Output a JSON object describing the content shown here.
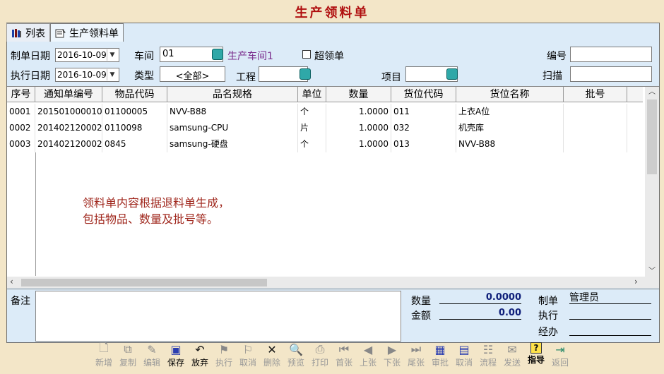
{
  "title": "生产领料单",
  "tabs": [
    {
      "label": "列表",
      "icon": "books-icon"
    },
    {
      "label": "生产领料单",
      "icon": "form-icon"
    }
  ],
  "form": {
    "make_date_label": "制单日期",
    "make_date": "2016-10-09",
    "exec_date_label": "执行日期",
    "exec_date": "2016-10-09",
    "workshop_label": "车间",
    "workshop_code": "01",
    "workshop_name": "生产车间1",
    "over_label": "超领单",
    "type_label": "类型",
    "type_value": "<全部>",
    "project_label": "工程",
    "item_label": "项目",
    "number_label": "编号",
    "scan_label": "扫描"
  },
  "grid": {
    "columns": [
      "序号",
      "通知单编号",
      "物品代码",
      "品名规格",
      "单位",
      "数量",
      "货位代码",
      "货位名称",
      "批号"
    ],
    "rows": [
      [
        "0001",
        "201501000010",
        "01100005",
        "NVV-B88",
        "个",
        "1.0000",
        "011",
        "上衣A位",
        ""
      ],
      [
        "0002",
        "201402120002",
        "0110098",
        "samsung-CPU",
        "片",
        "1.0000",
        "032",
        "机壳库",
        ""
      ],
      [
        "0003",
        "201402120002",
        "0845",
        "samsung-硬盘",
        "个",
        "1.0000",
        "013",
        "NVV-B88",
        ""
      ]
    ],
    "note_line1": "领料单内容根据退料单生成，",
    "note_line2": "包括物品、数量及批号等。"
  },
  "footer": {
    "remark_label": "备注",
    "qty_label": "数量",
    "qty_value": "0.0000",
    "amount_label": "金额",
    "amount_value": "0.00",
    "maker_label": "制单",
    "maker_value": "管理员",
    "executor_label": "执行",
    "handler_label": "经办"
  },
  "toolbar": [
    {
      "label": "新增",
      "icon": "new-doc-icon",
      "enabled": false
    },
    {
      "label": "复制",
      "icon": "copy-icon",
      "enabled": false
    },
    {
      "label": "编辑",
      "icon": "edit-icon",
      "enabled": false
    },
    {
      "label": "保存",
      "icon": "save-icon",
      "enabled": true
    },
    {
      "label": "放弃",
      "icon": "undo-icon",
      "enabled": true
    },
    {
      "label": "执行",
      "icon": "execute-icon",
      "enabled": false
    },
    {
      "label": "取消",
      "icon": "cancel-exec-icon",
      "enabled": false
    },
    {
      "label": "删除",
      "icon": "delete-icon",
      "enabled": false
    },
    {
      "label": "预览",
      "icon": "preview-icon",
      "enabled": false
    },
    {
      "label": "打印",
      "icon": "print-icon",
      "enabled": false
    },
    {
      "label": "首张",
      "icon": "first-icon",
      "enabled": false
    },
    {
      "label": "上张",
      "icon": "prev-icon",
      "enabled": false
    },
    {
      "label": "下张",
      "icon": "next-icon",
      "enabled": false
    },
    {
      "label": "尾张",
      "icon": "last-icon",
      "enabled": false
    },
    {
      "label": "审批",
      "icon": "approve-icon",
      "enabled": false
    },
    {
      "label": "取消",
      "icon": "cancel-approve-icon",
      "enabled": false
    },
    {
      "label": "流程",
      "icon": "flow-icon",
      "enabled": false
    },
    {
      "label": "发送",
      "icon": "send-icon",
      "enabled": false
    },
    {
      "label": "指导",
      "icon": "help-icon",
      "enabled": true
    },
    {
      "label": "返回",
      "icon": "return-icon",
      "enabled": false
    }
  ]
}
